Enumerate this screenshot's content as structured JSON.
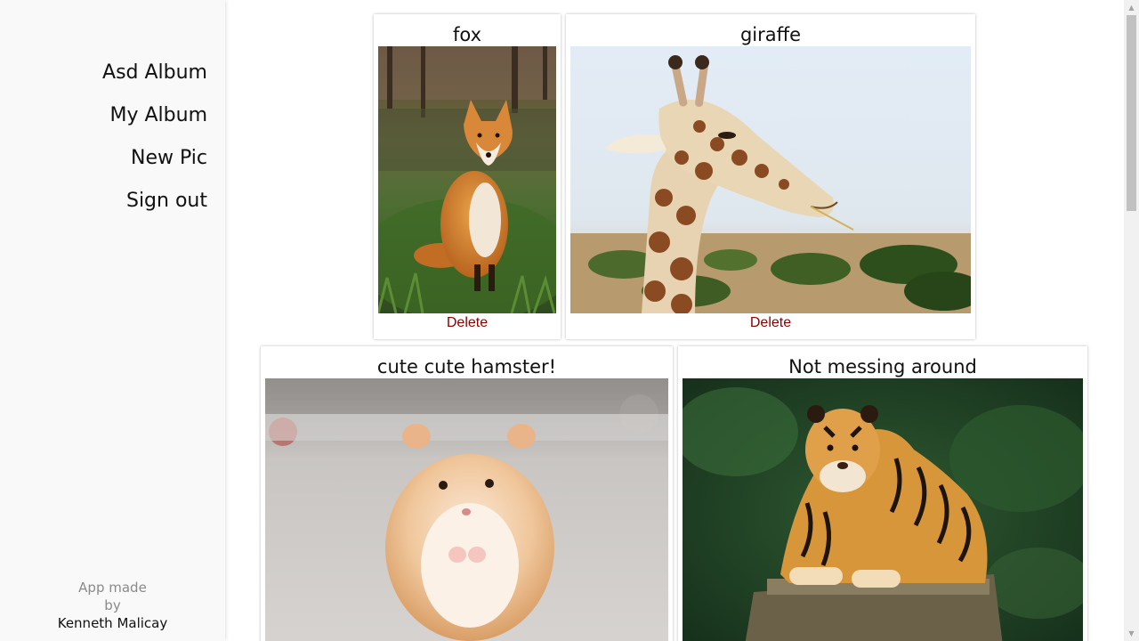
{
  "nav": {
    "items": [
      {
        "label": "Asd Album"
      },
      {
        "label": "My Album"
      },
      {
        "label": "New Pic"
      },
      {
        "label": "Sign out"
      }
    ]
  },
  "credit": {
    "line1": "App made",
    "line2": "by",
    "author": "Kenneth Malicay"
  },
  "pictures": [
    {
      "title": "fox",
      "delete_label": "Delete"
    },
    {
      "title": "giraffe",
      "delete_label": "Delete"
    },
    {
      "title": "cute cute hamster!"
    },
    {
      "title": "Not messing around"
    }
  ],
  "colors": {
    "delete": "#8b0000",
    "sidebar_bg": "#f9f9f9"
  },
  "icons": {
    "scroll_up": "scroll-up-arrow-icon",
    "scroll_down": "scroll-down-arrow-icon"
  }
}
